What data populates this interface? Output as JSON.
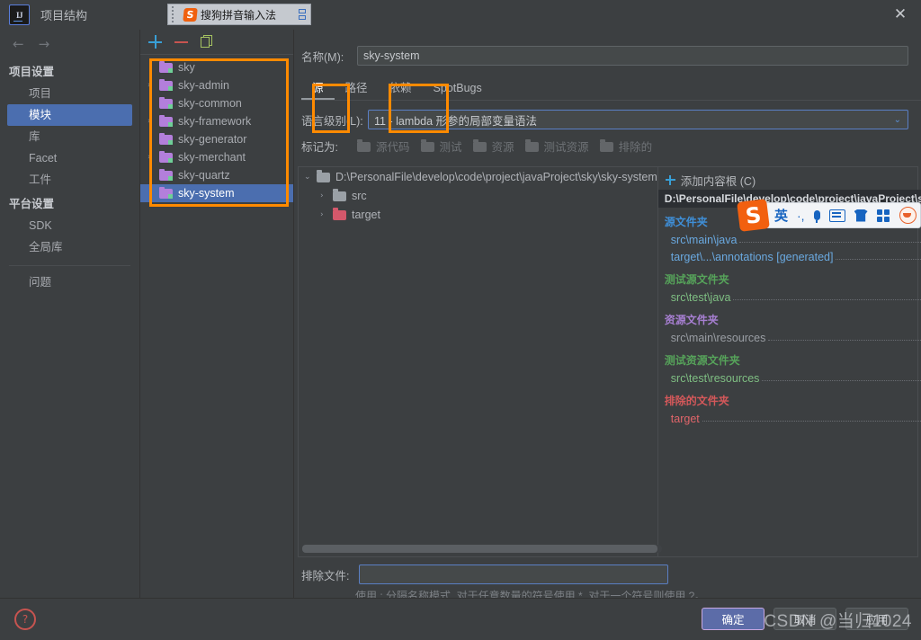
{
  "window": {
    "title": "项目结构",
    "app_icon": "IJ",
    "close_label": "✕"
  },
  "ime_titlebar": {
    "name": "搜狗拼音输入法",
    "logo": "S"
  },
  "ime_toolbar": {
    "items": [
      {
        "icon": "sogou-logo",
        "label": "S"
      },
      {
        "icon": "language-mode",
        "label": "英"
      },
      {
        "icon": "punctuation",
        "label": "·,"
      },
      {
        "icon": "microphone",
        "label": ""
      },
      {
        "icon": "soft-keyboard",
        "label": ""
      },
      {
        "icon": "skin",
        "label": ""
      },
      {
        "icon": "app-grid",
        "label": ""
      },
      {
        "icon": "emoji-face",
        "label": ""
      }
    ]
  },
  "leftnav": {
    "back_label": "←",
    "forward_label": "→",
    "groups": [
      {
        "title": "项目设置",
        "items": [
          {
            "label": "项目",
            "selected": false
          },
          {
            "label": "模块",
            "selected": true
          },
          {
            "label": "库",
            "selected": false
          },
          {
            "label": "Facet",
            "selected": false
          },
          {
            "label": "工件",
            "selected": false
          }
        ]
      },
      {
        "title": "平台设置",
        "items": [
          {
            "label": "SDK",
            "selected": false
          },
          {
            "label": "全局库",
            "selected": false
          }
        ]
      }
    ],
    "footer_item": "问题"
  },
  "modules_panel": {
    "toolbar": [
      {
        "name": "add",
        "glyph": "+"
      },
      {
        "name": "remove",
        "glyph": "−"
      },
      {
        "name": "copy",
        "glyph": "⧉"
      }
    ],
    "items": [
      {
        "label": "sky",
        "expandable": false,
        "selected": false
      },
      {
        "label": "sky-admin",
        "expandable": true,
        "selected": false
      },
      {
        "label": "sky-common",
        "expandable": false,
        "selected": false
      },
      {
        "label": "sky-framework",
        "expandable": true,
        "selected": false
      },
      {
        "label": "sky-generator",
        "expandable": false,
        "selected": false
      },
      {
        "label": "sky-merchant",
        "expandable": true,
        "selected": false
      },
      {
        "label": "sky-quartz",
        "expandable": false,
        "selected": false
      },
      {
        "label": "sky-system",
        "expandable": false,
        "selected": true
      }
    ]
  },
  "detail": {
    "name_label": "名称(M):",
    "name_value": "sky-system",
    "tabs": [
      {
        "label": "源",
        "active": true
      },
      {
        "label": "路径",
        "active": false
      },
      {
        "label": "依赖",
        "active": false
      },
      {
        "label": "SpotBugs",
        "active": false
      }
    ],
    "language_level_label": "语言级别(L):",
    "language_level_value": "11 - lambda 形参的局部变量语法",
    "mark_as_label": "标记为:",
    "mark_as_options": [
      "源代码",
      "测试",
      "资源",
      "测试资源",
      "排除的"
    ]
  },
  "tree": {
    "nodes": [
      {
        "label": "D:\\PersonalFile\\develop\\code\\project\\javaProject\\sky\\sky-system",
        "level": 0,
        "twisty": "⌄",
        "folder": "grey"
      },
      {
        "label": "src",
        "level": 1,
        "twisty": "›",
        "folder": "grey"
      },
      {
        "label": "target",
        "level": 1,
        "twisty": "›",
        "folder": "red"
      }
    ]
  },
  "content_roots": {
    "add_label": "添加内容根 (C)",
    "root_header": "D:\\PersonalFile\\develop\\code\\project\\javaProject\\sky\\sky-system",
    "groups": [
      {
        "title": "源文件夹",
        "kind": "src",
        "color": "#3f8fd8",
        "entries": [
          {
            "path": "src\\main\\java",
            "has_edit": true,
            "has_remove": true
          },
          {
            "path": "target\\...\\annotations [generated]",
            "has_edit": true,
            "has_remove": true
          }
        ]
      },
      {
        "title": "测试源文件夹",
        "kind": "test",
        "color": "#56a35a",
        "entries": [
          {
            "path": "src\\test\\java",
            "has_edit": true,
            "has_remove": true
          }
        ]
      },
      {
        "title": "资源文件夹",
        "kind": "res",
        "color": "#a77fd2",
        "entries": [
          {
            "path": "src\\main\\resources",
            "has_edit": true,
            "has_remove": true
          }
        ]
      },
      {
        "title": "测试资源文件夹",
        "kind": "tres",
        "color": "#56a35a",
        "entries": [
          {
            "path": "src\\test\\resources",
            "has_edit": true,
            "has_remove": true
          }
        ]
      },
      {
        "title": "排除的文件夹",
        "kind": "excl",
        "color": "#d4585a",
        "entries": [
          {
            "path": "target",
            "has_edit": false,
            "has_remove": true
          }
        ]
      }
    ]
  },
  "exclude": {
    "label": "排除文件:",
    "value": "",
    "hint": "使用 ; 分隔名称模式, 对于任意数量的符号使用 *, 对于一个符号则使用 ?。"
  },
  "bottom": {
    "help_label": "?",
    "buttons": [
      {
        "label": "确定",
        "primary": true
      },
      {
        "label": "取消",
        "primary": false
      },
      {
        "label": "应用",
        "primary": false
      }
    ]
  },
  "watermark": {
    "text": "CSDN @当归1024"
  },
  "annotations": {
    "color": "#ff8a00",
    "boxes": [
      {
        "name": "modules-list-highlight"
      },
      {
        "name": "sources-tab-highlight"
      },
      {
        "name": "dependencies-tab-highlight"
      }
    ]
  }
}
